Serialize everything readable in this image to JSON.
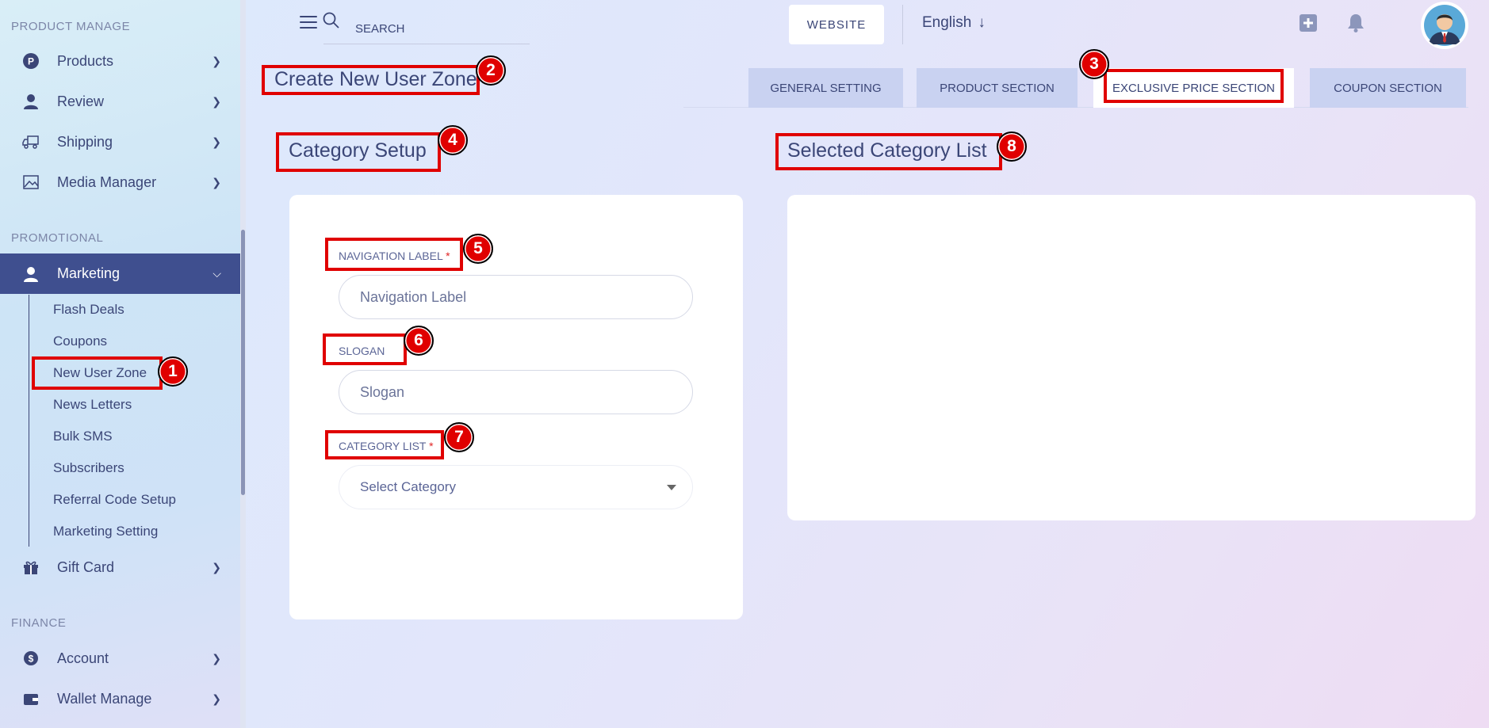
{
  "sidebar": {
    "section_product": "PRODUCT MANAGE",
    "section_promotional": "PROMOTIONAL",
    "section_finance": "FINANCE",
    "items": {
      "products": "Products",
      "review": "Review",
      "shipping": "Shipping",
      "media_manager": "Media Manager",
      "marketing": "Marketing",
      "gift_card": "Gift Card",
      "account": "Account",
      "wallet_manage": "Wallet Manage"
    },
    "marketing_sub": [
      "Flash Deals",
      "Coupons",
      "New User Zone",
      "News Letters",
      "Bulk SMS",
      "Subscribers",
      "Referral Code Setup",
      "Marketing Setting"
    ]
  },
  "header": {
    "search_placeholder": "SEARCH",
    "website_button": "WEBSITE",
    "language": "English"
  },
  "page": {
    "title": "Create New User Zone",
    "tabs": [
      "GENERAL SETTING",
      "PRODUCT SECTION",
      "EXCLUSIVE PRICE SECTION",
      "COUPON SECTION"
    ],
    "active_tab": "EXCLUSIVE PRICE SECTION"
  },
  "category_setup": {
    "title": "Category Setup",
    "navigation_label": "NAVIGATION LABEL",
    "navigation_placeholder": "Navigation Label",
    "slogan_label": "SLOGAN",
    "slogan_placeholder": "Slogan",
    "category_list_label": "CATEGORY LIST",
    "category_select_placeholder": "Select Category",
    "required_mark": "*"
  },
  "selected_list": {
    "title": "Selected Category List"
  },
  "annotations": [
    "1",
    "2",
    "3",
    "4",
    "5",
    "6",
    "7",
    "8"
  ],
  "colors": {
    "accent": "#3f4f8f",
    "highlight": "#e00000",
    "text": "#3b4677"
  }
}
